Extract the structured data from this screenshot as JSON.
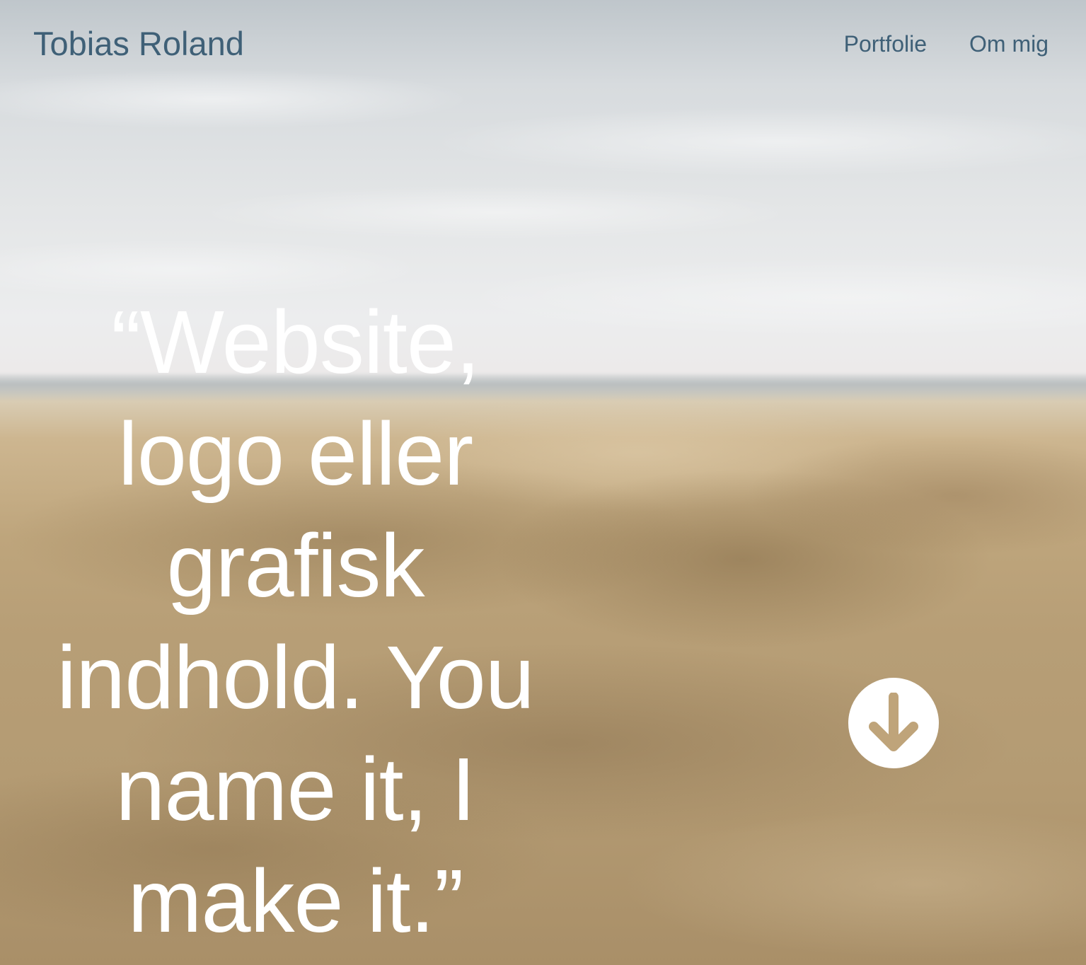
{
  "header": {
    "brand": "Tobias Roland",
    "nav": [
      {
        "label": "Portfolie"
      },
      {
        "label": "Om mig"
      }
    ]
  },
  "hero": {
    "quote": "“Website, logo eller grafisk indhold. You name it, I make it.”",
    "scroll_icon": "arrow-down-circle-icon"
  },
  "colors": {
    "nav_text": "#3f6077",
    "quote_text": "#ffffff",
    "button_bg": "#ffffff",
    "arrow": "#bfa47a"
  }
}
